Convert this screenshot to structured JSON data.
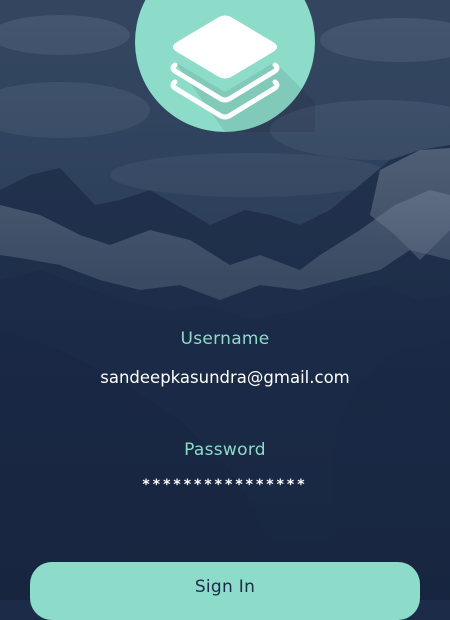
{
  "login": {
    "username_label": "Username",
    "username_value": "sandeepkasundra@gmail.com",
    "password_label": "Password",
    "password_value": "****************",
    "signin_label": "Sign In"
  },
  "logo": {
    "icon": "layers-icon",
    "circle_color": "#8ddcca"
  },
  "colors": {
    "accent": "#8ddcca",
    "background": "#1b2b48",
    "text": "#ffffff"
  }
}
